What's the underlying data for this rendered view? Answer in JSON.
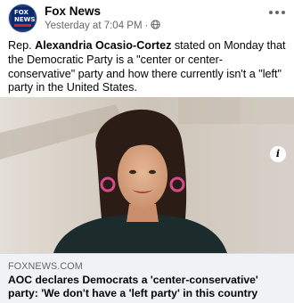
{
  "post": {
    "page_name": "Fox News",
    "timestamp": "Yesterday at 7:04 PM",
    "separator": "·",
    "avatar_text": {
      "line1": "FOX",
      "line2": "NEWS",
      "line3": "channel"
    },
    "caption": {
      "prefix": "Rep. ",
      "mention": "Alexandria Ocasio-Cortez",
      "suffix": " stated on Monday that the Democratic Party is a \"center or center-conservative\" party and how there currently isn't a \"left\" party in the United States."
    },
    "icons": {
      "privacy": "globe-icon",
      "menu": "more-options-icon",
      "info": "info-icon"
    }
  },
  "link_preview": {
    "domain": "FOXNEWS.COM",
    "headline": "AOC declares Democrats a 'center-conservative' party: 'We don't have a 'left party' in this country",
    "image_subject": "photo-of-alexandria-ocasio-cortez"
  },
  "colors": {
    "text_primary": "#050505",
    "text_secondary": "#65676b",
    "link_bg": "#f0f2f5",
    "fox_blue": "#0b2a6b",
    "fox_red": "#d81f26"
  }
}
